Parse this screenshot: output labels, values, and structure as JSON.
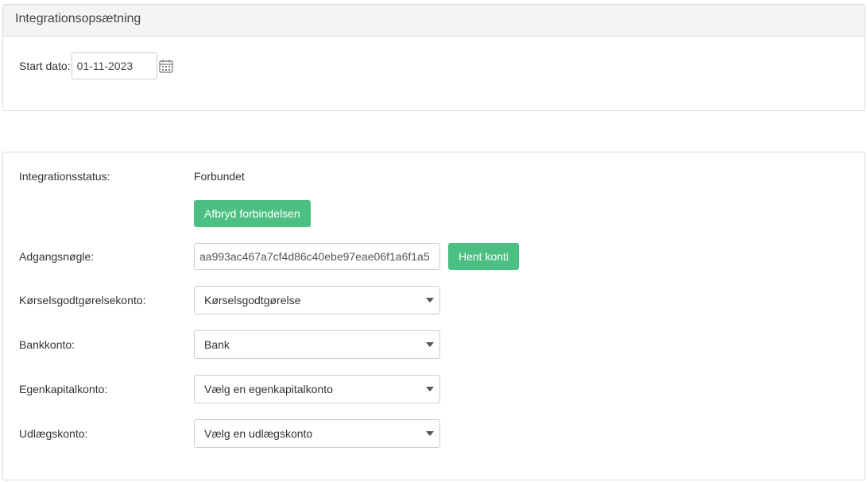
{
  "setup_panel": {
    "title": "Integrationsopsætning",
    "start_date_label": "Start dato:",
    "start_date_value": "01-11-2023"
  },
  "integration_panel": {
    "status_label": "Integrationsstatus:",
    "status_value": "Forbundet",
    "disconnect_button": "Afbryd forbindelsen",
    "access_key_label": "Adgangsnøgle:",
    "access_key_value": "aa993ac467a7cf4d86c40ebe97eae06f1a6f1a5",
    "fetch_accounts_button": "Hent konti",
    "mileage_account_label": "Kørselsgodtgørelsekonto:",
    "mileage_account_value": "Kørselsgodtgørelse",
    "bank_account_label": "Bankkonto:",
    "bank_account_value": "Bank",
    "equity_account_label": "Egenkapitalkonto:",
    "equity_account_value": "Vælg en egenkapitalkonto",
    "expense_account_label": "Udlægskonto:",
    "expense_account_value": "Vælg en udlægskonto"
  },
  "colors": {
    "button_green": "#4cc083",
    "heading_bg": "#f4f4f4",
    "border": "#d9d9d9"
  },
  "icons": {
    "date_picker": "calendar-icon",
    "select_caret": "caret-down-icon"
  }
}
